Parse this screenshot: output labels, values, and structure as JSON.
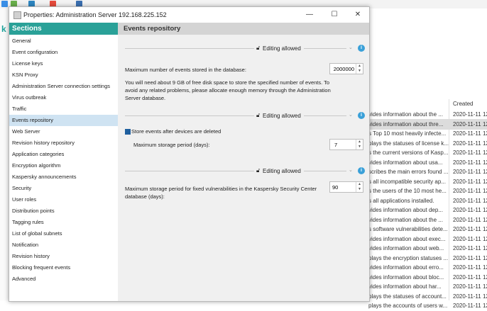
{
  "dialog": {
    "title": "Properties: Administration Server 192.168.225.152",
    "sections_header": "Sections",
    "content_header": "Events repository"
  },
  "window_controls": {
    "minimize": "—",
    "maximize": "☐",
    "close": "✕"
  },
  "sidebar": {
    "items": [
      {
        "label": "General"
      },
      {
        "label": "Event configuration"
      },
      {
        "label": "License keys"
      },
      {
        "label": "KSN Proxy"
      },
      {
        "label": "Administration Server connection settings"
      },
      {
        "label": "Virus outbreak"
      },
      {
        "label": "Traffic"
      },
      {
        "label": "Events repository"
      },
      {
        "label": "Web Server"
      },
      {
        "label": "Revision history repository"
      },
      {
        "label": "Application categories"
      },
      {
        "label": "Encryption algorithm"
      },
      {
        "label": "Kaspersky announcements"
      },
      {
        "label": "Security"
      },
      {
        "label": "User roles"
      },
      {
        "label": "Distribution points"
      },
      {
        "label": "Tagging rules"
      },
      {
        "label": "List of global subnets"
      },
      {
        "label": "Notification"
      },
      {
        "label": "Revision history"
      },
      {
        "label": "Blocking frequent events"
      },
      {
        "label": "Advanced"
      }
    ],
    "active": "Events repository"
  },
  "groups": [
    {
      "editing": "Editing allowed"
    },
    {
      "editing": "Editing allowed"
    },
    {
      "editing": "Editing allowed"
    }
  ],
  "fields": {
    "max_events_label": "Maximum number of events stored in the database:",
    "max_events_value": "2000000",
    "disk_note": "You will need about 9 GB of free disk space to store the specified number of events. To avoid any related problems, please allocate enough memory through the Administration Server database.",
    "store_events_label": "Store events after devices are deleted",
    "store_events_checked": true,
    "max_storage_label": "Maximum storage period (days):",
    "max_storage_value": "7",
    "vuln_storage_label": "Maximum storage period for fixed vulnerabilities in the Kaspersky Security Center database (days):",
    "vuln_storage_value": "90"
  },
  "background_list": {
    "header_created": "Created",
    "rows": [
      {
        "desc": "vides information about the ...",
        "created": "2020-11-11 12"
      },
      {
        "desc": "vides information about thre...",
        "created": "2020-11-11 12",
        "selected": true
      },
      {
        "desc": "s Top 10 most heavily infecte...",
        "created": "2020-11-11 12"
      },
      {
        "desc": "plays the statuses of license k...",
        "created": "2020-11-11 12"
      },
      {
        "desc": "s the current versions of Kasp...",
        "created": "2020-11-11 12"
      },
      {
        "desc": "vides information about usa...",
        "created": "2020-11-11 12"
      },
      {
        "desc": "scribes the main errors found ...",
        "created": "2020-11-11 12"
      },
      {
        "desc": "s all incompatible security ap...",
        "created": "2020-11-11 12"
      },
      {
        "desc": "s the users of the 10 most he...",
        "created": "2020-11-11 12"
      },
      {
        "desc": "s all applications installed.",
        "created": "2020-11-11 12"
      },
      {
        "desc": "vides information about dep...",
        "created": "2020-11-11 12"
      },
      {
        "desc": "vides information about the ...",
        "created": "2020-11-11 12"
      },
      {
        "desc": "s software vulnerabilities dete...",
        "created": "2020-11-11 12"
      },
      {
        "desc": "vides information about exec...",
        "created": "2020-11-11 12"
      },
      {
        "desc": "vides information about web...",
        "created": "2020-11-11 12"
      },
      {
        "desc": "plays the encryption statuses ...",
        "created": "2020-11-11 12"
      },
      {
        "desc": "vides information about erro...",
        "created": "2020-11-11 12"
      },
      {
        "desc": "vides information about bloc...",
        "created": "2020-11-11 12"
      },
      {
        "desc": "vides information about har...",
        "created": "2020-11-11 12"
      },
      {
        "desc": "plays the statuses of account...",
        "created": "2020-11-11 12"
      },
      {
        "desc": "plays the accounts of users w...",
        "created": "2020-11-11 12"
      }
    ]
  },
  "colors": {
    "accent": "#2aa198",
    "selected_section": "#cfe3f2",
    "info": "#3aa0d8"
  }
}
